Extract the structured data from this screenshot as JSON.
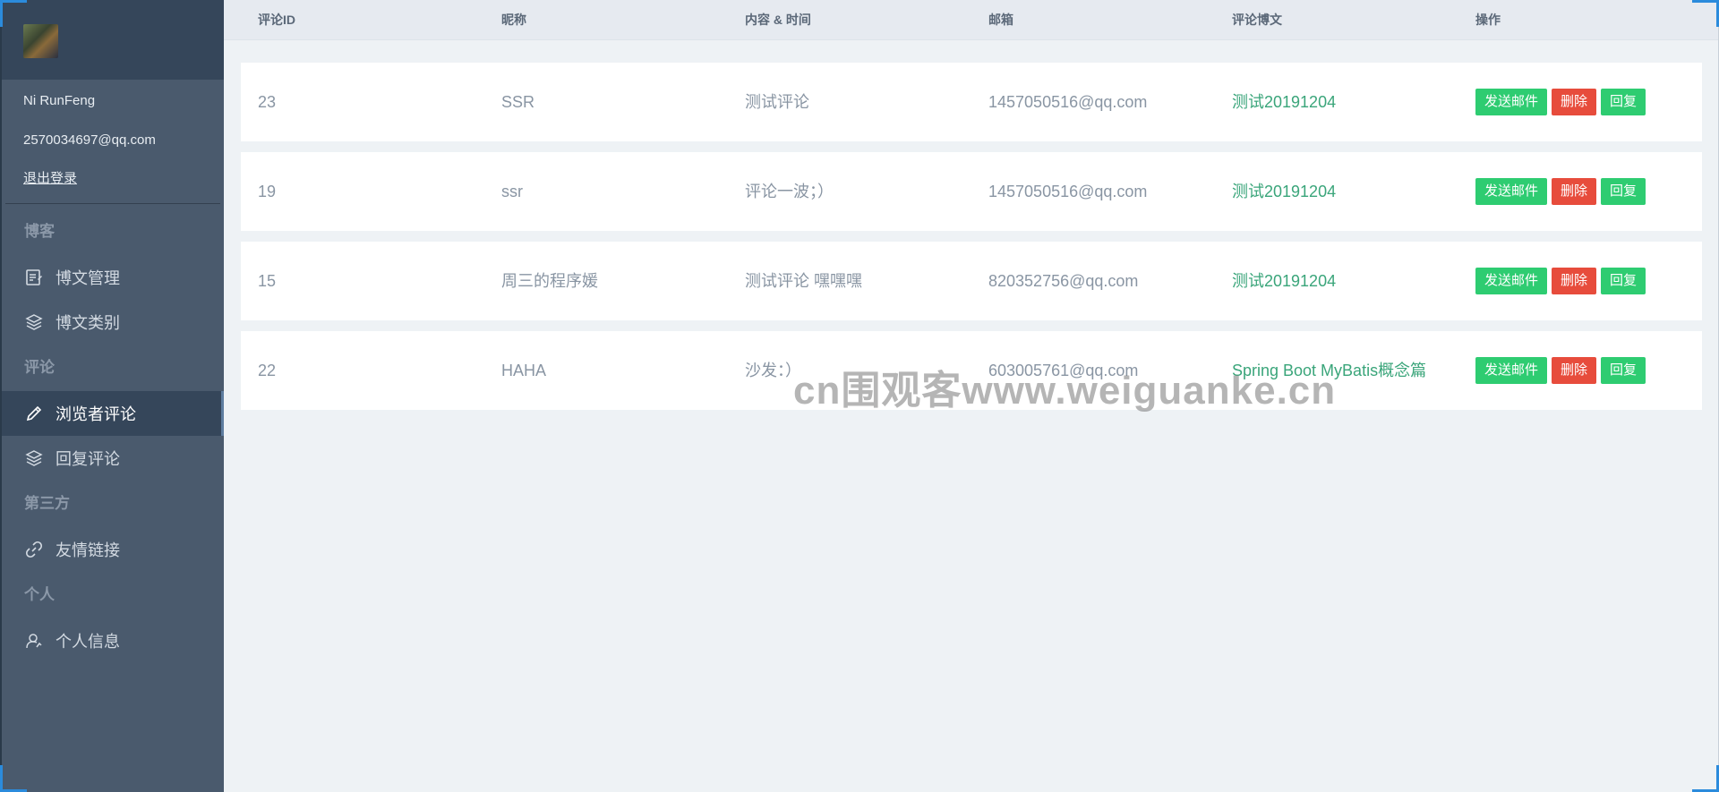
{
  "sidebar": {
    "user_name": "Ni RunFeng",
    "user_email": "2570034697@qq.com",
    "logout_label": "退出登录",
    "sections": [
      {
        "title": "博客",
        "items": [
          {
            "label": "博文管理",
            "icon": "document-edit-icon"
          },
          {
            "label": "博文类别",
            "icon": "layers-icon"
          }
        ]
      },
      {
        "title": "评论",
        "items": [
          {
            "label": "浏览者评论",
            "icon": "pencil-icon",
            "active": true
          },
          {
            "label": "回复评论",
            "icon": "layers-icon"
          }
        ]
      },
      {
        "title": "第三方",
        "items": [
          {
            "label": "友情链接",
            "icon": "link-icon"
          }
        ]
      },
      {
        "title": "个人",
        "items": [
          {
            "label": "个人信息",
            "icon": "user-icon"
          }
        ]
      }
    ]
  },
  "table": {
    "headers": {
      "id": "评论ID",
      "nickname": "昵称",
      "content": "内容 & 时间",
      "email": "邮箱",
      "post": "评论博文",
      "actions": "操作"
    },
    "rows": [
      {
        "id": "23",
        "nickname": "SSR",
        "content": "测试评论",
        "email": "1457050516@qq.com",
        "post": "测试20191204"
      },
      {
        "id": "19",
        "nickname": "ssr",
        "content": "评论一波；）",
        "email": "1457050516@qq.com",
        "post": "测试20191204"
      },
      {
        "id": "15",
        "nickname": "周三的程序媛",
        "content": "测试评论 嘿嘿嘿",
        "email": "820352756@qq.com",
        "post": "测试20191204"
      },
      {
        "id": "22",
        "nickname": "HAHA",
        "content": "沙发：）",
        "email": "603005761@qq.com",
        "post": "Spring Boot MyBatis概念篇"
      }
    ],
    "buttons": {
      "send_mail": "发送邮件",
      "delete": "删除",
      "reply": "回复"
    }
  },
  "watermark": "cn围观客www.weiguanke.cn",
  "colors": {
    "sidebar_bg": "#4a5a6d",
    "sidebar_header_bg": "#35465a",
    "main_bg": "#eef2f5",
    "link_green": "#3aa57a",
    "btn_green": "#2ecc71",
    "btn_red": "#e74c3c"
  }
}
